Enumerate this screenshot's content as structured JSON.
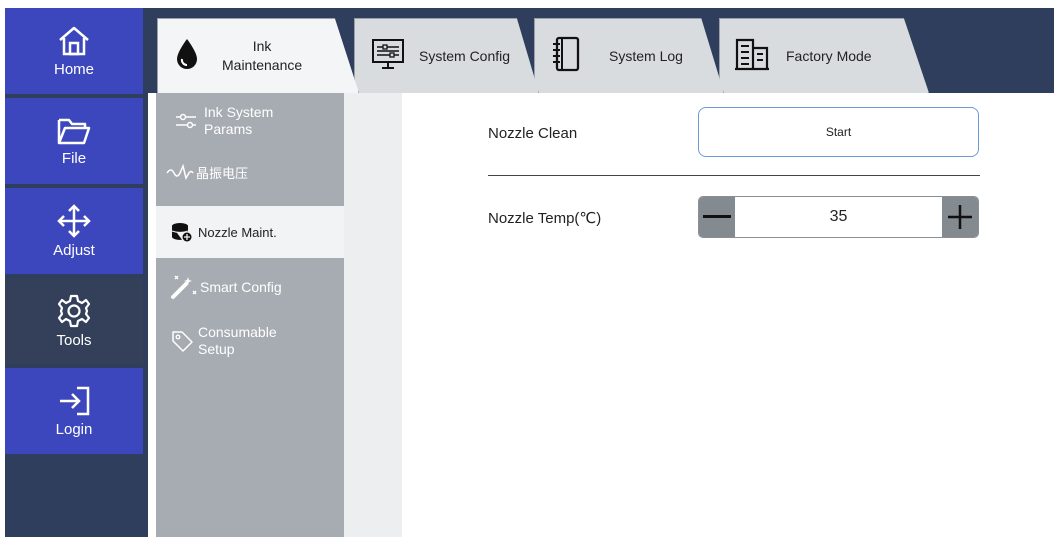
{
  "nav": {
    "items": [
      {
        "label": "Home",
        "icon": "home-icon"
      },
      {
        "label": "File",
        "icon": "folder-icon"
      },
      {
        "label": "Adjust",
        "icon": "move-arrows-icon"
      },
      {
        "label": "Tools",
        "icon": "gear-icon"
      },
      {
        "label": "Login",
        "icon": "login-icon"
      }
    ],
    "active": "Tools"
  },
  "tabs": {
    "ink_line1": "Ink",
    "ink_line2": "Maintenance",
    "system_config": "System Config",
    "system_log": "System Log",
    "factory_mode": "Factory Mode",
    "active": "Ink Maintenance"
  },
  "submenu": {
    "ink_system_line1": "Ink System",
    "ink_system_line2": "Params",
    "crystal_voltage": "晶振电压",
    "nozzle_maint": "Nozzle Maint.",
    "smart_config": "Smart Config",
    "consumable_line1": "Consumable",
    "consumable_line2": "Setup",
    "active": "Nozzle Maint."
  },
  "content": {
    "nozzle_clean_label": "Nozzle Clean",
    "start_label": "Start",
    "nozzle_temp_label": "Nozzle Temp(℃)",
    "nozzle_temp_value": "35",
    "minus_symbol": "—",
    "plus_symbol": "+"
  },
  "colors": {
    "nav_blue": "#3d47bd",
    "nav_dark": "#2f3e5c",
    "submenu_gray": "#a6acb2",
    "button_border": "#6b9bd2",
    "stepper_gray": "#838a90"
  }
}
